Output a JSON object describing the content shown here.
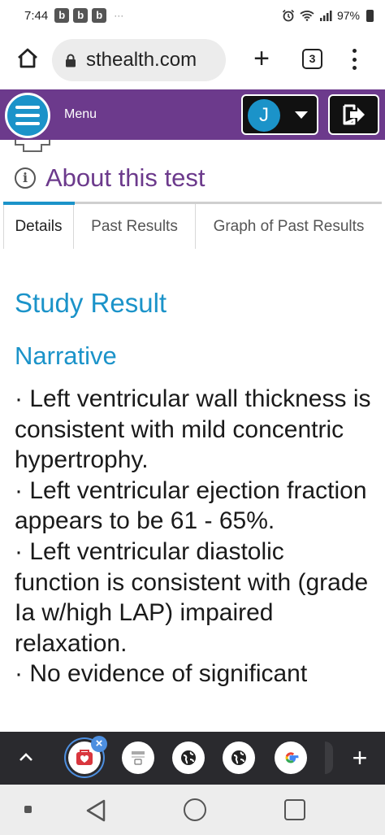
{
  "status_bar": {
    "time": "7:44",
    "notif_badges": [
      "b",
      "b",
      "b"
    ],
    "dots": "···",
    "battery": "97%"
  },
  "browser": {
    "url": "sthealth.com",
    "tab_count": "3"
  },
  "app_header": {
    "menu_label": "Menu",
    "avatar_initial": "J",
    "colors": {
      "header_bg": "#6c3a8c",
      "accent": "#1b93c9"
    }
  },
  "page": {
    "section_title": "About this test",
    "tabs": [
      {
        "label": "Details",
        "selected": true
      },
      {
        "label": "Past Results",
        "selected": false
      },
      {
        "label": "Graph of Past Results",
        "selected": false
      }
    ],
    "study_result_heading": "Study Result",
    "narrative_heading": "Narrative",
    "narrative_lines": [
      "· Left ventricular wall thickness is consistent with mild concentric hypertrophy.",
      "· Left ventricular ejection fraction appears to be 61 - 65%.",
      "· Left ventricular diastolic function is consistent with (grade Ia w/high LAP) impaired relaxation.",
      "· No evidence of significant"
    ]
  },
  "bottom_toolbar": {
    "tab_icons": [
      "health-app-icon",
      "document-icon",
      "globe-icon",
      "globe-icon",
      "google-icon"
    ]
  }
}
